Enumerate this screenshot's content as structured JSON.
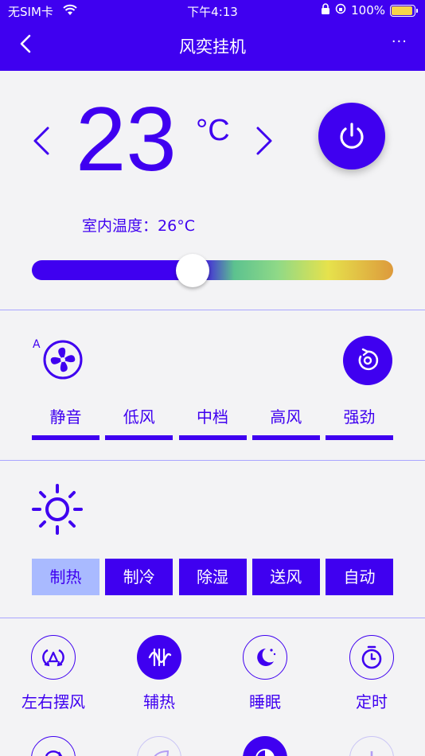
{
  "status_bar": {
    "carrier": "无SIM卡",
    "time": "下午4:13",
    "battery": "100%"
  },
  "nav": {
    "title": "风奕挂机",
    "more": "···"
  },
  "temperature": {
    "value": "23",
    "unit": "°C",
    "indoor_label": "室内温度：",
    "indoor_value": "26°C",
    "slider_level_fraction": 0.44
  },
  "fan": {
    "auto_label": "A",
    "speeds": [
      {
        "label": "静音"
      },
      {
        "label": "低风"
      },
      {
        "label": "中档"
      },
      {
        "label": "高风"
      },
      {
        "label": "强劲"
      }
    ]
  },
  "mode": {
    "options": [
      {
        "label": "制热",
        "active": true
      },
      {
        "label": "制冷"
      },
      {
        "label": "除湿"
      },
      {
        "label": "送风"
      },
      {
        "label": "自动"
      }
    ]
  },
  "functions": [
    {
      "label": "左右摆风",
      "icon": "swing-lr-icon",
      "on": false
    },
    {
      "label": "辅热",
      "icon": "aux-heat-icon",
      "on": true
    },
    {
      "label": "睡眠",
      "icon": "sleep-icon",
      "on": false
    },
    {
      "label": "定时",
      "icon": "timer-icon",
      "on": false
    }
  ],
  "colors": {
    "accent": "#3f00f0",
    "inactive_mode": "#a9baff",
    "background": "#f3f3f5"
  }
}
